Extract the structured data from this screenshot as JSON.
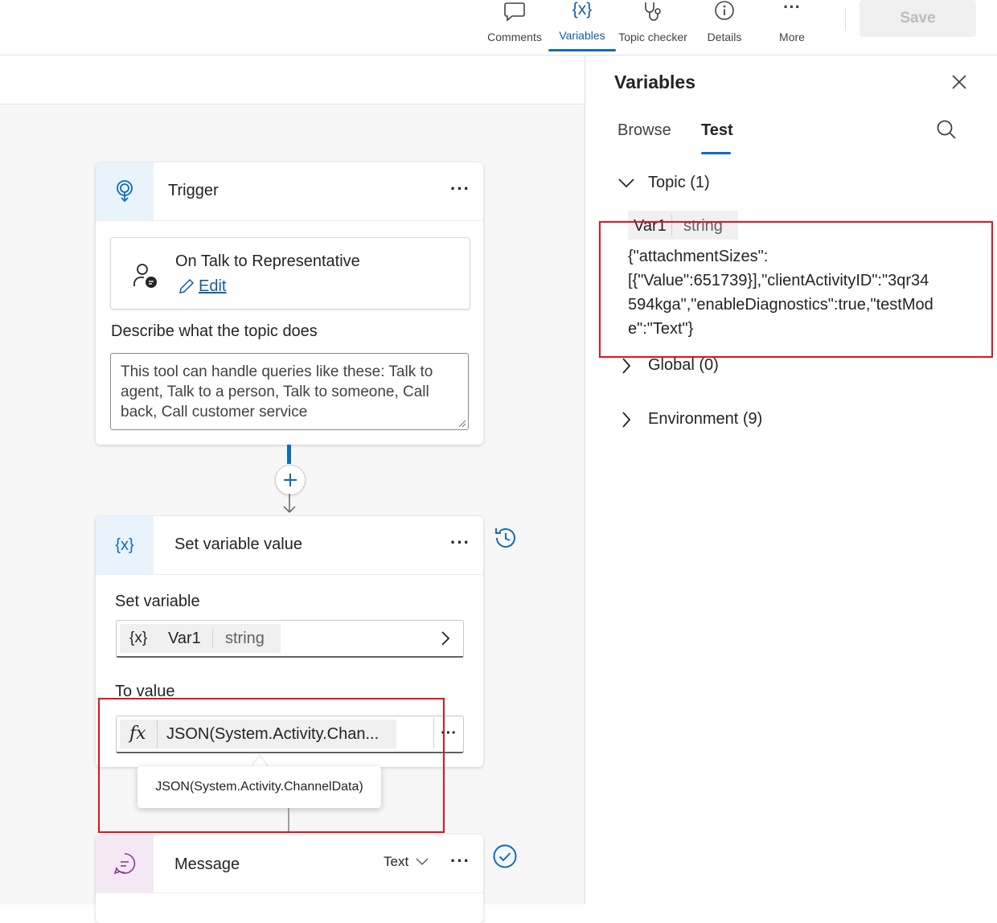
{
  "toolbar": {
    "comments_label": "Comments",
    "variables_label": "Variables",
    "topic_checker_label": "Topic checker",
    "details_label": "Details",
    "more_label": "More",
    "save_label": "Save"
  },
  "trigger_node": {
    "title": "Trigger",
    "trigger_name": "On Talk to Representative",
    "edit_label": "Edit",
    "describe_label": "Describe what the topic does",
    "description": "This tool can handle queries like these: Talk to agent, Talk to a person, Talk to someone, Call back, Call customer service"
  },
  "set_variable_node": {
    "title": "Set variable value",
    "set_variable_label": "Set variable",
    "variable_icon": "{x}",
    "variable_name": "Var1",
    "variable_type": "string",
    "to_value_label": "To value",
    "formula_icon": "fx",
    "formula_preview": "JSON(System.Activity.Chan...",
    "formula_tooltip": "JSON(System.Activity.ChannelData)"
  },
  "message_node": {
    "title": "Message",
    "mode": "Text"
  },
  "variables_panel": {
    "title": "Variables",
    "tabs": [
      "Browse",
      "Test"
    ],
    "active_tab": "Test",
    "sections": {
      "topic": "Topic (1)",
      "global": "Global (0)",
      "environment": "Environment (9)"
    },
    "var_name": "Var1",
    "var_type": "string",
    "value_lines": [
      "{\"attachmentSizes\":",
      "[{\"Value\":651739}],\"clientActivityID\":\"3qr34",
      "594kga\",\"enableDiagnostics\":true,\"testMod",
      "e\":\"Text\"}"
    ]
  },
  "colors": {
    "accent": "#0f6cbd",
    "highlight_border": "#e0141e",
    "message_icon": "#8a3c8f"
  }
}
